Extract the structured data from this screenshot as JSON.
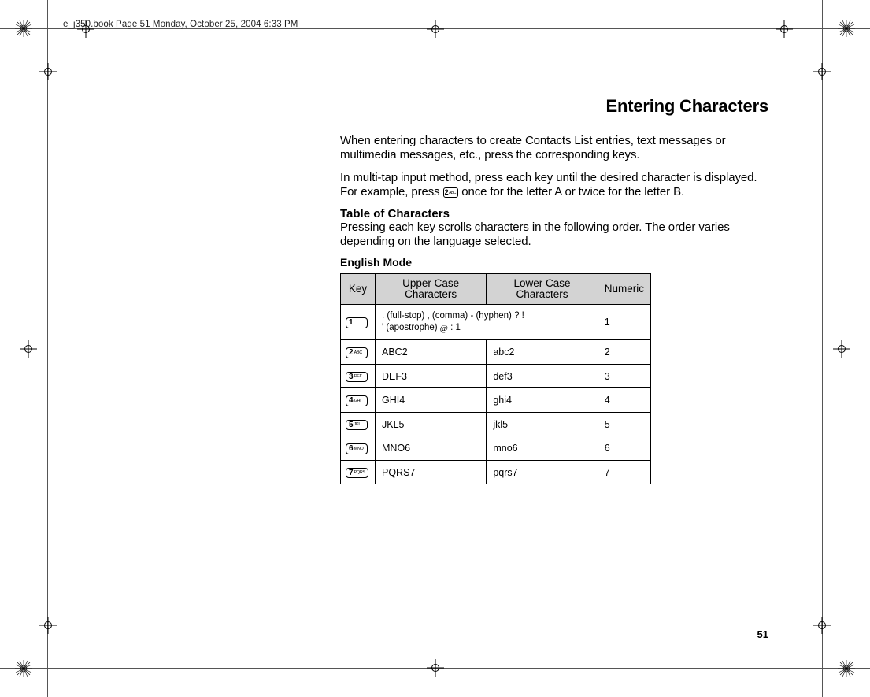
{
  "running_head": "e_j350.book  Page 51  Monday, October 25, 2004  6:33 PM",
  "page_number": "51",
  "title": "Entering Characters",
  "para1": "When entering characters to create Contacts List entries, text messages or multimedia messages, etc., press the corresponding keys.",
  "para2_a": "In multi-tap input method, press each key until the desired character is displayed. For example, press ",
  "para2_key_digit": "2",
  "para2_key_letters": "ABC",
  "para2_b": " once for the letter A or twice for the letter B.",
  "subhead": "Table of Characters",
  "subhead_note": "Pressing each key scrolls characters in the following order. The order varies depending on the language selected.",
  "mode_label": "English Mode",
  "table": {
    "headers": {
      "key": "Key",
      "upper": "Upper Case Characters",
      "lower": "Lower Case Characters",
      "numeric": "Numeric"
    },
    "rows": [
      {
        "digit": "1",
        "letters": "",
        "span": ". (full-stop) , (comma) - (hyphen) ? ! ' (apostrophe) @ : 1",
        "numeric": "1"
      },
      {
        "digit": "2",
        "letters": "ABC",
        "upper": "ABC2",
        "lower": "abc2",
        "numeric": "2"
      },
      {
        "digit": "3",
        "letters": "DEF",
        "upper": "DEF3",
        "lower": "def3",
        "numeric": "3"
      },
      {
        "digit": "4",
        "letters": "GHI",
        "upper": "GHI4",
        "lower": "ghi4",
        "numeric": "4"
      },
      {
        "digit": "5",
        "letters": "JKL",
        "upper": "JKL5",
        "lower": "jkl5",
        "numeric": "5"
      },
      {
        "digit": "6",
        "letters": "MNO",
        "upper": "MNO6",
        "lower": "mno6",
        "numeric": "6"
      },
      {
        "digit": "7",
        "letters": "PQRS",
        "upper": "PQRS7",
        "lower": "pqrs7",
        "numeric": "7"
      }
    ]
  }
}
